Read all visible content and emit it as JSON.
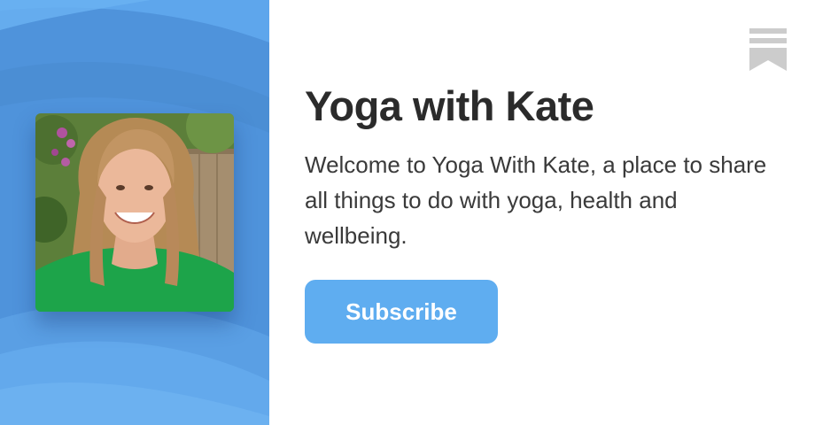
{
  "publication": {
    "title": "Yoga with Kate",
    "description": "Welcome to Yoga With Kate, a place to share all things to do with yoga, health and wellbeing.",
    "subscribe_label": "Subscribe",
    "avatar_icon": "profile-photo",
    "bookmark_icon": "bookmark-icon"
  },
  "colors": {
    "panel_blue": "#4f93db",
    "button_blue": "#5fadf0",
    "title_text": "#2b2b2b",
    "bookmark_gray": "#cccccc"
  }
}
